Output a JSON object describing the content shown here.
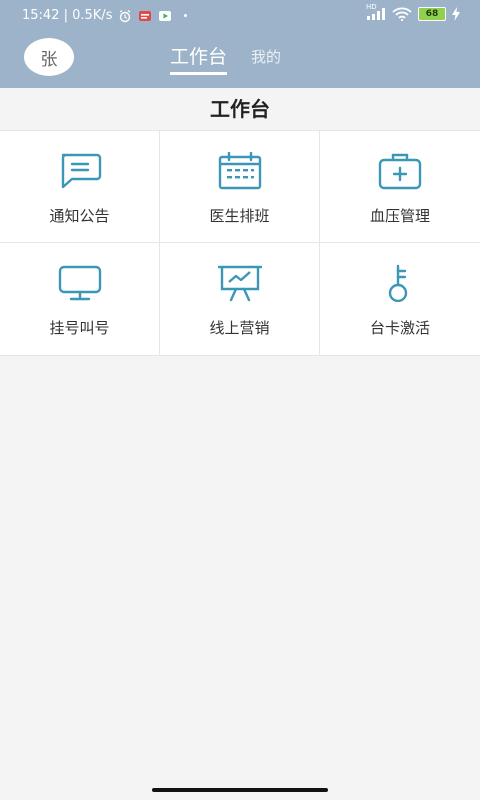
{
  "status_bar": {
    "time_speed": "15:42 | 0.5K/s",
    "battery": "68",
    "signal_tag": "HD"
  },
  "header": {
    "avatar_text": "张",
    "tabs": [
      {
        "label": "工作台",
        "active": true
      },
      {
        "label": "我的",
        "active": false
      }
    ]
  },
  "main": {
    "title": "工作台",
    "items": [
      {
        "label": "通知公告",
        "icon": "message-icon"
      },
      {
        "label": "医生排班",
        "icon": "calendar-icon"
      },
      {
        "label": "血压管理",
        "icon": "medical-kit-icon"
      },
      {
        "label": "挂号叫号",
        "icon": "monitor-icon"
      },
      {
        "label": "线上营销",
        "icon": "presentation-chart-icon"
      },
      {
        "label": "台卡激活",
        "icon": "key-icon"
      }
    ]
  },
  "colors": {
    "header_bg": "#9db3c9",
    "icon_color": "#3b97b5",
    "page_bg": "#f4f4f4"
  }
}
